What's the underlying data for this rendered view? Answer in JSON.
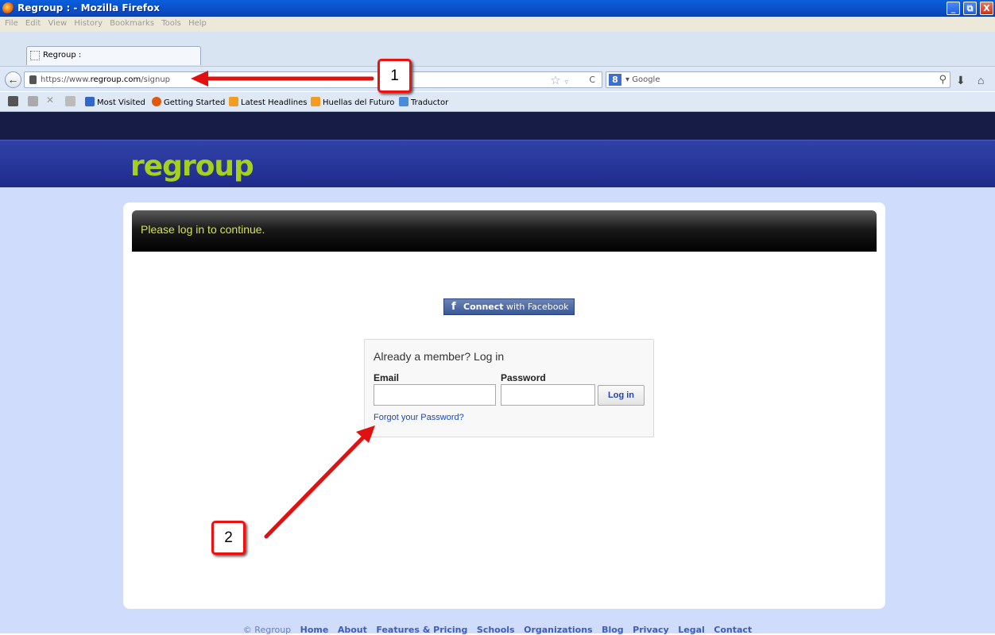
{
  "window": {
    "title": "Regroup : - Mozilla Firefox",
    "min": "_",
    "max": "⧉",
    "close": "X"
  },
  "menu": [
    "File",
    "Edit",
    "View",
    "History",
    "Bookmarks",
    "Tools",
    "Help"
  ],
  "tab": {
    "label": "Regroup :"
  },
  "nav": {
    "url_prefix": "https://www.",
    "url_domain": "regroup.com",
    "url_path": "/signup",
    "search_placeholder": "Google",
    "search_engine_letter": "8"
  },
  "bookmarks": [
    {
      "label": "Most Visited",
      "color": "#3366cc"
    },
    {
      "label": "Getting Started",
      "color": "#e0580b"
    },
    {
      "label": "Latest Headlines",
      "color": "#f29d22"
    },
    {
      "label": "Huellas del Futuro",
      "color": "#f29d22"
    },
    {
      "label": "Traductor",
      "color": "#4a8ad8"
    }
  ],
  "site": {
    "logo": "regroup",
    "banner": "Please log in to continue.",
    "facebook": {
      "f": "f",
      "bold": "Connect",
      "rest": " with Facebook"
    },
    "login": {
      "title": "Already a member? Log in",
      "email_label": "Email",
      "password_label": "Password",
      "button": "Log in",
      "forgot": "Forgot your Password?"
    },
    "footer": {
      "copyright": "© Regroup",
      "links": [
        "Home",
        "About",
        "Features & Pricing",
        "Schools",
        "Organizations",
        "Blog",
        "Privacy",
        "Legal",
        "Contact"
      ]
    }
  },
  "annotations": {
    "a1": "1",
    "a2": "2"
  },
  "colors": {
    "logo": "#a4d01e",
    "banner_text": "#d6e34c",
    "annotation_red": "#e11111"
  }
}
